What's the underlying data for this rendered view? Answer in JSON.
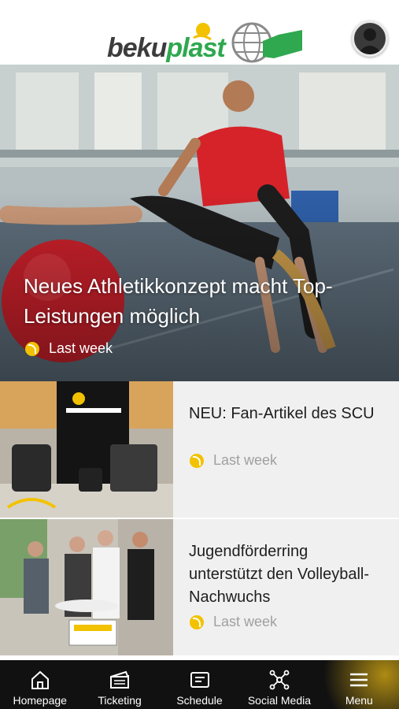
{
  "header": {
    "logo_part1": "beku",
    "logo_part2": "plast"
  },
  "hero": {
    "title": "Neues Athletikkonzept macht Top-Leistungen möglich",
    "time": "Last week"
  },
  "articles": [
    {
      "title": "NEU: Fan-Artikel des SCU",
      "time": "Last week"
    },
    {
      "title": "Jugendförderring unterstützt den Volleyball-Nachwuchs",
      "time": "Last week"
    }
  ],
  "nav": [
    {
      "label": "Homepage",
      "icon": "home-icon"
    },
    {
      "label": "Ticketing",
      "icon": "ticket-icon"
    },
    {
      "label": "Schedule",
      "icon": "schedule-icon"
    },
    {
      "label": "Social Media",
      "icon": "social-network-icon"
    },
    {
      "label": "Menu",
      "icon": "menu-icon"
    }
  ],
  "colors": {
    "brand_green": "#2fa84f",
    "brand_yellow": "#f2c200",
    "nav_bg": "#111111",
    "row_bg": "#f0f0f0"
  }
}
